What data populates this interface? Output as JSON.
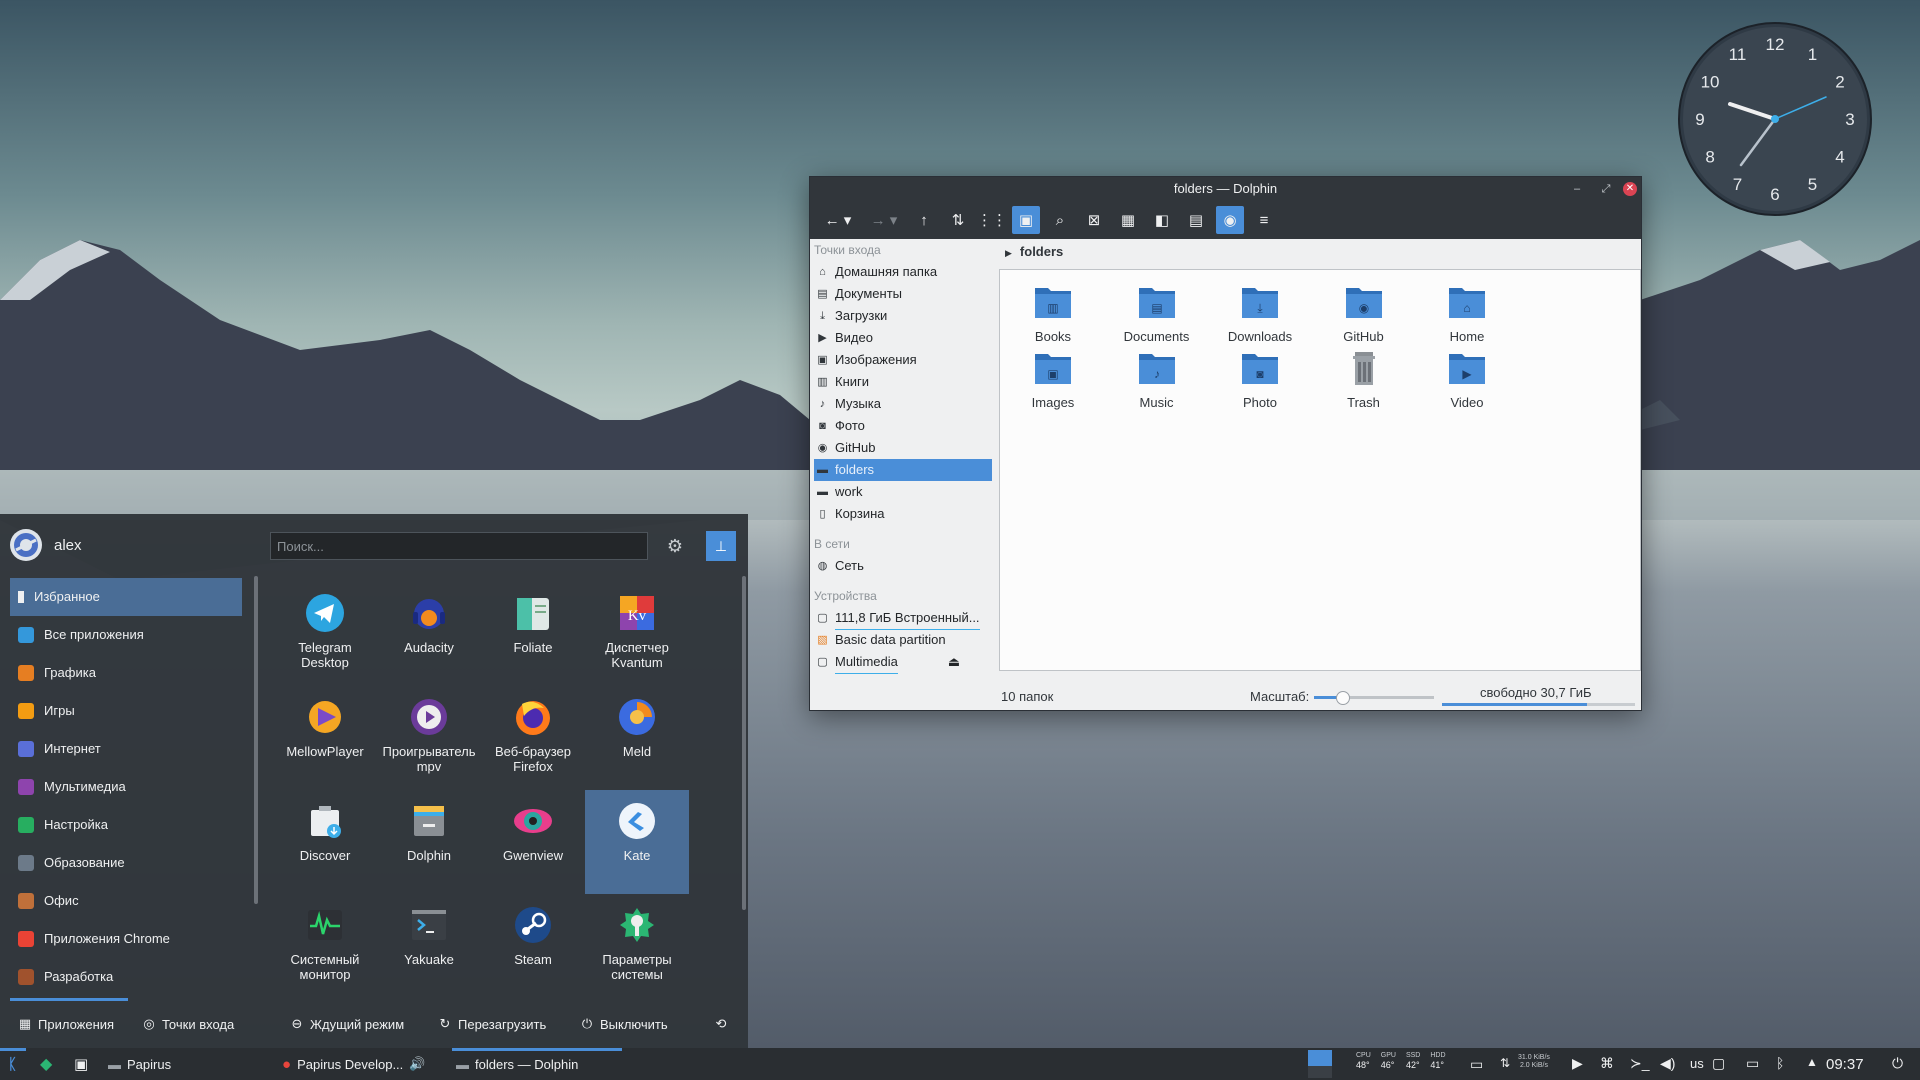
{
  "clock": {
    "numerals": [
      "12",
      "1",
      "2",
      "3",
      "4",
      "5",
      "6",
      "7",
      "8",
      "9",
      "10",
      "11"
    ]
  },
  "dolphin": {
    "title": "folders — Dolphin",
    "breadcrumb": "folders",
    "places_sections": {
      "entry": "Точки входа",
      "network": "В сети",
      "devices": "Устройства"
    },
    "places": [
      {
        "label": "Домашняя папка",
        "icon": "home-icon"
      },
      {
        "label": "Документы",
        "icon": "document-icon"
      },
      {
        "label": "Загрузки",
        "icon": "download-icon"
      },
      {
        "label": "Видео",
        "icon": "video-icon"
      },
      {
        "label": "Изображения",
        "icon": "image-icon"
      },
      {
        "label": "Книги",
        "icon": "book-icon"
      },
      {
        "label": "Музыка",
        "icon": "music-icon"
      },
      {
        "label": "Фото",
        "icon": "camera-icon"
      },
      {
        "label": "GitHub",
        "icon": "github-icon"
      },
      {
        "label": "folders",
        "icon": "folder-icon"
      },
      {
        "label": "work",
        "icon": "folder-icon"
      },
      {
        "label": "Корзина",
        "icon": "trash-icon"
      }
    ],
    "network": [
      {
        "label": "Сеть",
        "icon": "network-icon"
      }
    ],
    "devices": [
      {
        "label": "111,8 ГиБ Встроенный...",
        "icon": "disk-icon"
      },
      {
        "label": "Basic data partition",
        "icon": "partition-icon"
      },
      {
        "label": "Multimedia",
        "icon": "disk-icon"
      }
    ],
    "files": [
      "Books",
      "Documents",
      "Downloads",
      "GitHub",
      "Home",
      "Images",
      "Music",
      "Photo",
      "Trash",
      "Video"
    ],
    "status": {
      "count": "10 папок",
      "zoom_label": "Масштаб:",
      "zoom": 0.25,
      "free": "свободно 30,7 ГиБ",
      "used": 0.75
    }
  },
  "menu": {
    "user": "alex",
    "search_placeholder": "Поиск...",
    "categories": [
      "Избранное",
      "Все приложения",
      "Графика",
      "Игры",
      "Интернет",
      "Мультимедиа",
      "Настройка",
      "Образование",
      "Офис",
      "Приложения Chrome",
      "Разработка"
    ],
    "apps": [
      "Telegram Desktop",
      "Audacity",
      "Foliate",
      "Диспетчер Kvantum",
      "MellowPlayer",
      "Проигрыватель mpv",
      "Веб-браузер Firefox",
      "Meld",
      "Discover",
      "Dolphin",
      "Gwenview",
      "Kate",
      "Системный монитор",
      "Yakuake",
      "Steam",
      "Параметры системы"
    ],
    "bottom": {
      "apps": "Приложения",
      "places": "Точки входа",
      "sleep": "Ждущий режим",
      "reboot": "Перезагрузить",
      "shutdown": "Выключить"
    }
  },
  "taskbar": {
    "tasks": [
      "Papirus",
      "Papirus Develop...",
      "folders — Dolphin"
    ],
    "temps": {
      "labels": [
        "CPU",
        "GPU",
        "SSD",
        "HDD"
      ],
      "values": [
        "48°",
        "46°",
        "42°",
        "41°"
      ]
    },
    "net": {
      "up": "31.0 KiB/s",
      "down": "2.0 KiB/s"
    },
    "layout": "us",
    "time": "09:37"
  },
  "colors": {
    "accent": "#4a8ed8",
    "panel": "#31363b",
    "folder": "#4a8ed8"
  }
}
